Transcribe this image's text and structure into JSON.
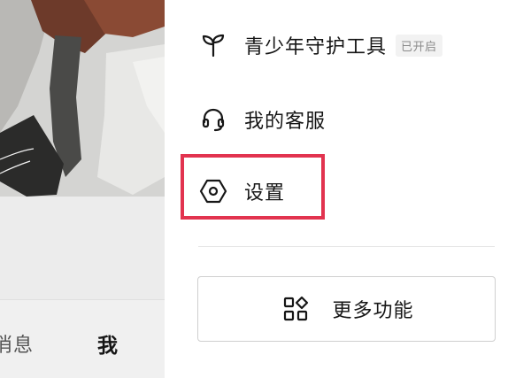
{
  "background_page": {
    "tabbar": {
      "messages_tab_partial_label": "消息",
      "me_tab_label": "我"
    }
  },
  "drawer": {
    "menu_items": [
      {
        "label": "青少年守护工具",
        "icon": "sprout-icon",
        "status_badge": "已开启"
      },
      {
        "label": "我的客服",
        "icon": "headset-icon"
      },
      {
        "label": "设置",
        "icon": "hexagon-settings-icon",
        "highlighted": true
      }
    ],
    "more_button": {
      "label": "更多功能",
      "icon": "grid-apps-icon"
    }
  },
  "colors": {
    "highlight_border": "#e2334f",
    "text_primary": "#161616",
    "badge_text": "#8a8a8a",
    "badge_background": "#f2f2f2"
  }
}
